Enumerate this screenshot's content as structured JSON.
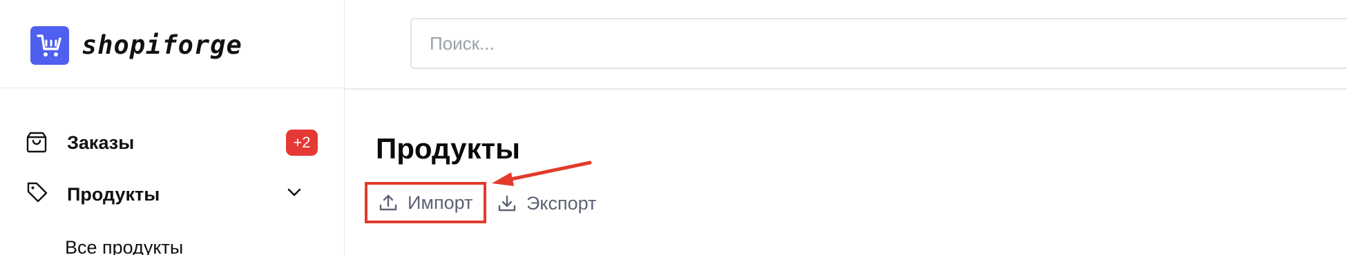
{
  "brand": {
    "name": "shopiforge",
    "logo_icon": "cart-icon",
    "logo_color": "#4f5ff0"
  },
  "search": {
    "placeholder": "Поиск..."
  },
  "sidebar": {
    "items": [
      {
        "label": "Заказы",
        "icon": "shopping-bag-icon",
        "badge": "+2"
      },
      {
        "label": "Продукты",
        "icon": "tag-icon",
        "expanded": true,
        "children": [
          {
            "label": "Все продукты"
          }
        ]
      }
    ]
  },
  "main": {
    "title": "Продукты",
    "actions": {
      "import_label": "Импорт",
      "export_label": "Экспорт"
    }
  },
  "colors": {
    "badge": "#e53935",
    "highlight": "#e23b2a",
    "muted_text": "#5b6272"
  }
}
